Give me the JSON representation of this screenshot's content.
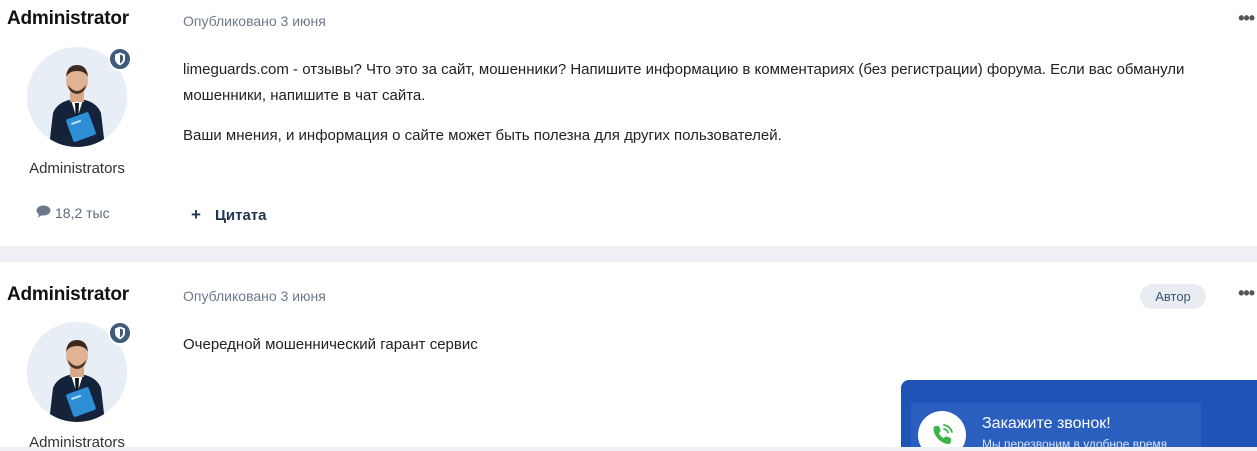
{
  "posts": [
    {
      "author": "Administrator",
      "group": "Administrators",
      "posts_count": "18,2 тыс",
      "date": "Опубликовано 3 июня",
      "paragraphs": [
        "limeguards.com - отзывы? Что это за сайт, мошенники? Напишите информацию в комментариях (без регистрации) форума. Если вас обманули мошенники, напишите в чат сайта.",
        "Ваши мнения, и информация о сайте может быть полезна для других пользователей."
      ],
      "quote_label": "Цитата",
      "menu": "•••"
    },
    {
      "author": "Administrator",
      "group": "Administrators",
      "date": "Опубликовано 3 июня",
      "author_tag": "Автор",
      "paragraphs": [
        "Очередной мошеннический гарант сервис"
      ],
      "menu": "•••"
    }
  ],
  "callback": {
    "title": "Закажите звонок!",
    "subtitle": "Мы перезвоним в удобное время"
  },
  "colors": {
    "callback_bg": "#1f54b6",
    "badge": "#3d5b7b",
    "phone_icon": "#3bb54a"
  }
}
